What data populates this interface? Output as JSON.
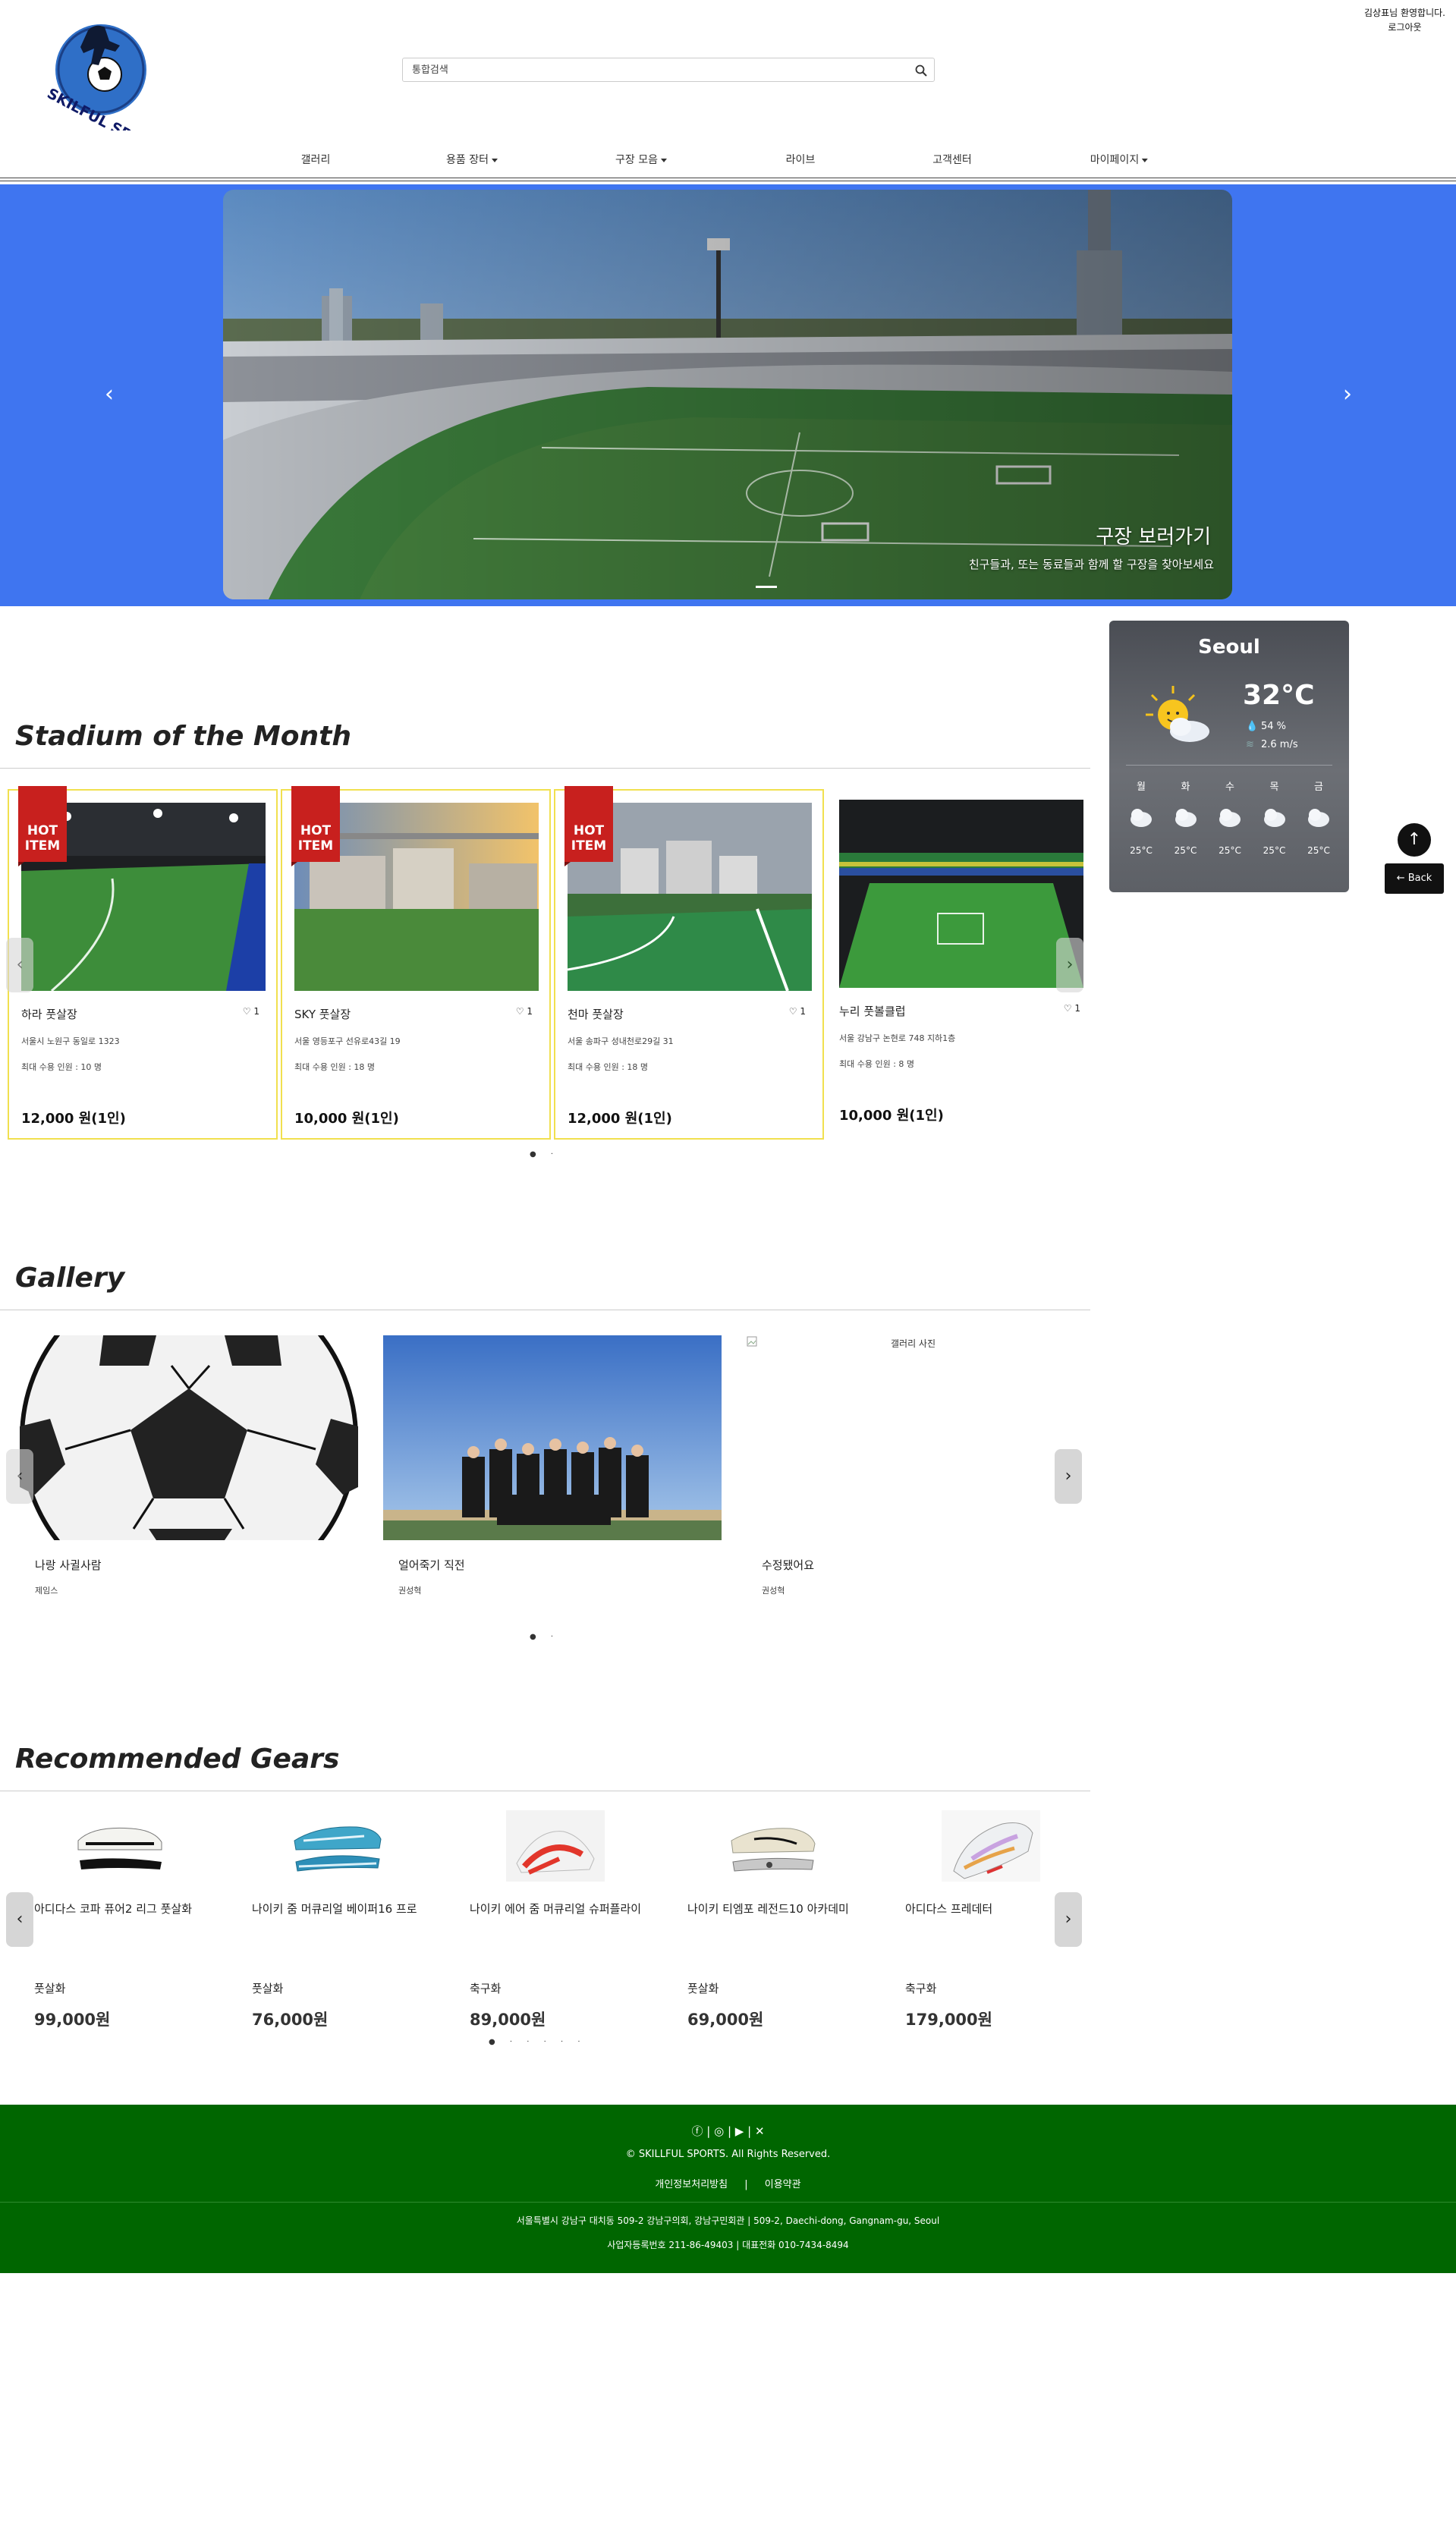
{
  "header": {
    "welcome": "김상표님 환영합니다.",
    "logout": "로그아웃",
    "logo_text": "SKILFUL SPORTS",
    "search_placeholder": "통합검색"
  },
  "nav": {
    "items": [
      {
        "label": "갤러리",
        "dropdown": false
      },
      {
        "label": "용품 장터",
        "dropdown": true
      },
      {
        "label": "구장 모음",
        "dropdown": true
      },
      {
        "label": "라이브",
        "dropdown": false
      },
      {
        "label": "고객센터",
        "dropdown": false
      },
      {
        "label": "마이페이지",
        "dropdown": true
      }
    ]
  },
  "hero": {
    "title": "구장 보러가기",
    "subtitle": "친구들과, 또는 동료들과 함께 할 구장을 찾아보세요",
    "bg_color": "#3f75f0"
  },
  "weather": {
    "city": "Seoul",
    "temp": "32°C",
    "humidity": "54 %",
    "wind": "2.6 m/s",
    "days": [
      {
        "day": "월",
        "temp": "25°C"
      },
      {
        "day": "화",
        "temp": "25°C"
      },
      {
        "day": "수",
        "temp": "25°C"
      },
      {
        "day": "목",
        "temp": "25°C"
      },
      {
        "day": "금",
        "temp": "25°C"
      }
    ]
  },
  "stadiums": {
    "title": "Stadium of the Month",
    "badge": "HOT ITEM",
    "items": [
      {
        "name": "하라 풋살장",
        "likes": "1",
        "address": "서울시 노원구 동일로 1323",
        "capacity": "최대 수용 인원 : 10 명",
        "price": "12,000 원(1인)",
        "hot": true
      },
      {
        "name": "SKY 풋살장",
        "likes": "1",
        "address": "서울 영등포구 선유로43길 19",
        "capacity": "최대 수용 인원 : 18 명",
        "price": "10,000 원(1인)",
        "hot": true
      },
      {
        "name": "천마 풋살장",
        "likes": "1",
        "address": "서울 송파구 성내천로29길 31",
        "capacity": "최대 수용 인원 : 18 명",
        "price": "12,000 원(1인)",
        "hot": true
      },
      {
        "name": "누리 풋볼클럽",
        "likes": "1",
        "address": "서울 강남구 논현로 748 지하1층",
        "capacity": "최대 수용 인원 : 8 명",
        "price": "10,000 원(1인)",
        "hot": false
      }
    ]
  },
  "gallery": {
    "title": "Gallery",
    "items": [
      {
        "title": "나랑 사귈사람",
        "author": "제임스"
      },
      {
        "title": "얼어죽기 직전",
        "author": "권성혁"
      },
      {
        "title": "수정됐어요",
        "author": "권성혁",
        "alt": "갤러리 사진"
      }
    ]
  },
  "gears": {
    "title": "Recommended Gears",
    "items": [
      {
        "name": "아디다스 코파 퓨어2 리그 풋살화",
        "category": "풋살화",
        "price": "99,000원"
      },
      {
        "name": "나이키 줌 머큐리얼 베이퍼16 프로",
        "category": "풋살화",
        "price": "76,000원"
      },
      {
        "name": "나이키 에어 줌 머큐리얼 슈퍼플라이",
        "category": "축구화",
        "price": "89,000원"
      },
      {
        "name": "나이키 티엠포 레전드10 아카데미",
        "category": "풋살화",
        "price": "69,000원"
      },
      {
        "name": "아디다스 프레데터",
        "category": "축구화",
        "price": "179,000원"
      }
    ]
  },
  "footer": {
    "copyright": "© SKILLFUL SPORTS. All Rights Reserved.",
    "privacy": "개인정보처리방침",
    "separator": "|",
    "terms": "이용약관",
    "address": "서울특별시 강남구 대치동 509-2 강남구의회, 강남구민회관 | 509-2, Daechi-dong, Gangnam-gu, Seoul",
    "business": "사업자등록번호 211-86-49403 | 대표전화 010-7434-8494",
    "bg_color": "#006600"
  },
  "floating": {
    "top": "↑",
    "back": "← Back"
  }
}
